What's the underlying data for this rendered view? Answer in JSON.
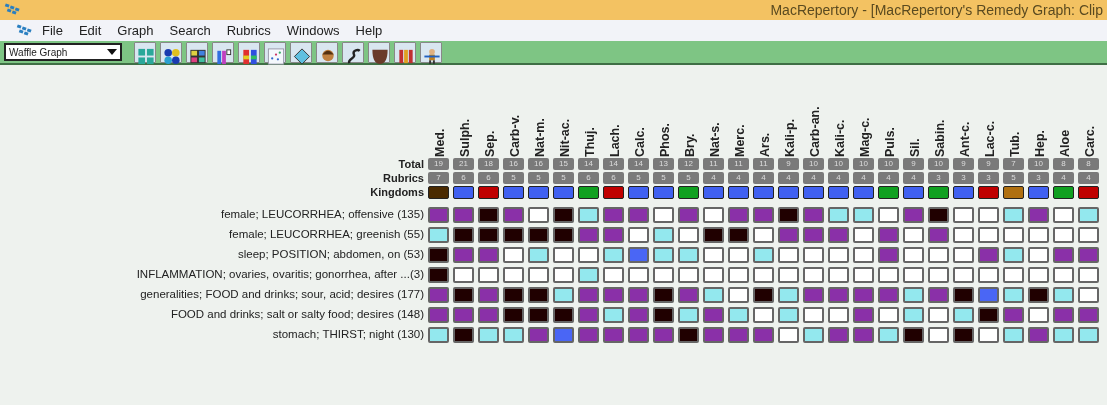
{
  "window": {
    "title": "MacRepertory - [MacRepertory's Remedy Graph: Clip"
  },
  "menu": [
    "File",
    "Edit",
    "Graph",
    "Search",
    "Rubrics",
    "Windows",
    "Help"
  ],
  "toolbar": {
    "view_select": "Waffle Graph"
  },
  "header_labels": {
    "total": "Total",
    "rubrics": "Rubrics",
    "kingdoms": "Kingdoms"
  },
  "remedies": [
    {
      "name": "Med.",
      "total": "19",
      "rubrics": "7",
      "color": "#4a2a00"
    },
    {
      "name": "Sulph.",
      "total": "21",
      "rubrics": "6",
      "color": "#4060f0"
    },
    {
      "name": "Sep.",
      "total": "18",
      "rubrics": "6",
      "color": "#c00000"
    },
    {
      "name": "Carb-v.",
      "total": "16",
      "rubrics": "5",
      "color": "#4060f0"
    },
    {
      "name": "Nat-m.",
      "total": "16",
      "rubrics": "5",
      "color": "#4060f0"
    },
    {
      "name": "Nit-ac.",
      "total": "15",
      "rubrics": "5",
      "color": "#4060f0"
    },
    {
      "name": "Thuj.",
      "total": "14",
      "rubrics": "6",
      "color": "#10a020"
    },
    {
      "name": "Lach.",
      "total": "14",
      "rubrics": "6",
      "color": "#c00000"
    },
    {
      "name": "Calc.",
      "total": "14",
      "rubrics": "5",
      "color": "#4060f0"
    },
    {
      "name": "Phos.",
      "total": "13",
      "rubrics": "5",
      "color": "#4060f0"
    },
    {
      "name": "Bry.",
      "total": "12",
      "rubrics": "5",
      "color": "#10a020"
    },
    {
      "name": "Nat-s.",
      "total": "11",
      "rubrics": "4",
      "color": "#4060f0"
    },
    {
      "name": "Merc.",
      "total": "11",
      "rubrics": "4",
      "color": "#4060f0"
    },
    {
      "name": "Ars.",
      "total": "11",
      "rubrics": "4",
      "color": "#4060f0"
    },
    {
      "name": "Kali-p.",
      "total": "9",
      "rubrics": "4",
      "color": "#4060f0"
    },
    {
      "name": "Carb-an.",
      "total": "10",
      "rubrics": "4",
      "color": "#4060f0"
    },
    {
      "name": "Kali-c.",
      "total": "10",
      "rubrics": "4",
      "color": "#4060f0"
    },
    {
      "name": "Mag-c.",
      "total": "10",
      "rubrics": "4",
      "color": "#4060f0"
    },
    {
      "name": "Puls.",
      "total": "10",
      "rubrics": "4",
      "color": "#10a020"
    },
    {
      "name": "Sil.",
      "total": "9",
      "rubrics": "4",
      "color": "#4060f0"
    },
    {
      "name": "Sabin.",
      "total": "10",
      "rubrics": "3",
      "color": "#10a020"
    },
    {
      "name": "Ant-c.",
      "total": "9",
      "rubrics": "3",
      "color": "#4060f0"
    },
    {
      "name": "Lac-c.",
      "total": "9",
      "rubrics": "3",
      "color": "#c00000"
    },
    {
      "name": "Tub.",
      "total": "7",
      "rubrics": "5",
      "color": "#b07010"
    },
    {
      "name": "Hep.",
      "total": "10",
      "rubrics": "3",
      "color": "#4060f0"
    },
    {
      "name": "Aloe",
      "total": "8",
      "rubrics": "4",
      "color": "#10a020"
    },
    {
      "name": "Carc.",
      "total": "8",
      "rubrics": "4",
      "color": "#c00000"
    }
  ],
  "rows": [
    {
      "label": "female; LEUCORRHEA; offensive (135)",
      "cells": [
        {
          "color": "#8a30a8"
        },
        {
          "color": "#8a30a8"
        },
        {
          "color": "#200000"
        },
        {
          "color": "#8a30a8"
        },
        {
          "color": "#ffffff"
        },
        {
          "color": "#200000"
        },
        {
          "color": "#93e8ee"
        },
        {
          "color": "#8a30a8"
        },
        {
          "color": "#8a30a8"
        },
        {
          "color": "#ffffff"
        },
        {
          "color": "#8a30a8"
        },
        {
          "color": "#ffffff"
        },
        {
          "color": "#8a30a8"
        },
        {
          "color": "#8a30a8"
        },
        {
          "color": "#200000"
        },
        {
          "color": "#8a30a8"
        },
        {
          "color": "#93e8ee"
        },
        {
          "color": "#93e8ee"
        },
        {
          "color": "#ffffff"
        },
        {
          "color": "#8a30a8"
        },
        {
          "color": "#200000"
        },
        {
          "color": "#ffffff"
        },
        {
          "color": "#ffffff"
        },
        {
          "color": "#93e8ee"
        },
        {
          "color": "#8a30a8"
        },
        {
          "color": "#ffffff"
        },
        {
          "color": "#93e8ee"
        }
      ]
    },
    {
      "label": "female; LEUCORRHEA; greenish (55)",
      "cells": [
        {
          "color": "#93e8ee"
        },
        {
          "color": "#200000"
        },
        {
          "color": "#200000"
        },
        {
          "color": "#200000"
        },
        {
          "color": "#200000"
        },
        {
          "color": "#200000"
        },
        {
          "color": "#8a30a8"
        },
        {
          "color": "#8a30a8"
        },
        {
          "color": "#ffffff"
        },
        {
          "color": "#93e8ee"
        },
        {
          "color": "#ffffff"
        },
        {
          "color": "#200000"
        },
        {
          "color": "#200000"
        },
        {
          "color": "#ffffff"
        },
        {
          "color": "#8a30a8"
        },
        {
          "color": "#8a30a8"
        },
        {
          "color": "#8a30a8"
        },
        {
          "color": "#ffffff"
        },
        {
          "color": "#8a30a8"
        },
        {
          "color": "#ffffff"
        },
        {
          "color": "#8a30a8"
        },
        {
          "color": "#ffffff"
        },
        {
          "color": "#ffffff"
        },
        {
          "color": "#ffffff"
        },
        {
          "color": "#ffffff"
        },
        {
          "color": "#ffffff"
        },
        {
          "color": "#ffffff"
        }
      ]
    },
    {
      "label": "sleep; POSITION; abdomen, on (53)",
      "cells": [
        {
          "color": "#200000"
        },
        {
          "color": "#8a30a8"
        },
        {
          "color": "#8a30a8"
        },
        {
          "color": "#ffffff"
        },
        {
          "color": "#93e8ee"
        },
        {
          "color": "#ffffff"
        },
        {
          "color": "#ffffff"
        },
        {
          "color": "#93e8ee"
        },
        {
          "color": "#4a66f5"
        },
        {
          "color": "#93e8ee"
        },
        {
          "color": "#93e8ee"
        },
        {
          "color": "#ffffff"
        },
        {
          "color": "#ffffff"
        },
        {
          "color": "#93e8ee"
        },
        {
          "color": "#ffffff"
        },
        {
          "color": "#ffffff"
        },
        {
          "color": "#ffffff"
        },
        {
          "color": "#ffffff"
        },
        {
          "color": "#8a30a8"
        },
        {
          "color": "#ffffff"
        },
        {
          "color": "#ffffff"
        },
        {
          "color": "#ffffff"
        },
        {
          "color": "#8a30a8"
        },
        {
          "color": "#93e8ee"
        },
        {
          "color": "#ffffff"
        },
        {
          "color": "#8a30a8"
        },
        {
          "color": "#8a30a8"
        }
      ]
    },
    {
      "label": "INFLAMMATION; ovaries, ovaritis; gonorrhea, after ...(3)",
      "cells": [
        {
          "color": "#200000"
        },
        {
          "color": "#ffffff"
        },
        {
          "color": "#ffffff"
        },
        {
          "color": "#ffffff"
        },
        {
          "color": "#ffffff"
        },
        {
          "color": "#ffffff"
        },
        {
          "color": "#93e8ee"
        },
        {
          "color": "#ffffff"
        },
        {
          "color": "#ffffff"
        },
        {
          "color": "#ffffff"
        },
        {
          "color": "#ffffff"
        },
        {
          "color": "#ffffff"
        },
        {
          "color": "#ffffff"
        },
        {
          "color": "#ffffff"
        },
        {
          "color": "#ffffff"
        },
        {
          "color": "#ffffff"
        },
        {
          "color": "#ffffff"
        },
        {
          "color": "#ffffff"
        },
        {
          "color": "#ffffff"
        },
        {
          "color": "#ffffff"
        },
        {
          "color": "#ffffff"
        },
        {
          "color": "#ffffff"
        },
        {
          "color": "#ffffff"
        },
        {
          "color": "#ffffff"
        },
        {
          "color": "#ffffff"
        },
        {
          "color": "#ffffff"
        },
        {
          "color": "#ffffff"
        }
      ]
    },
    {
      "label": "generalities; FOOD and drinks; sour, acid; desires (177)",
      "cells": [
        {
          "color": "#8a30a8"
        },
        {
          "color": "#200000"
        },
        {
          "color": "#8a30a8"
        },
        {
          "color": "#200000"
        },
        {
          "color": "#200000"
        },
        {
          "color": "#93e8ee"
        },
        {
          "color": "#8a30a8"
        },
        {
          "color": "#8a30a8"
        },
        {
          "color": "#8a30a8"
        },
        {
          "color": "#200000"
        },
        {
          "color": "#8a30a8"
        },
        {
          "color": "#93e8ee"
        },
        {
          "color": "#ffffff"
        },
        {
          "color": "#200000"
        },
        {
          "color": "#93e8ee"
        },
        {
          "color": "#8a30a8"
        },
        {
          "color": "#8a30a8"
        },
        {
          "color": "#8a30a8"
        },
        {
          "color": "#8a30a8"
        },
        {
          "color": "#93e8ee"
        },
        {
          "color": "#8a30a8"
        },
        {
          "color": "#200000"
        },
        {
          "color": "#4a66f5"
        },
        {
          "color": "#93e8ee"
        },
        {
          "color": "#200000"
        },
        {
          "color": "#93e8ee"
        },
        {
          "color": "#ffffff"
        }
      ]
    },
    {
      "label": "FOOD and drinks; salt or salty food; desires (148)",
      "cells": [
        {
          "color": "#8a30a8"
        },
        {
          "color": "#8a30a8"
        },
        {
          "color": "#8a30a8"
        },
        {
          "color": "#200000"
        },
        {
          "color": "#200000"
        },
        {
          "color": "#200000"
        },
        {
          "color": "#8a30a8"
        },
        {
          "color": "#93e8ee"
        },
        {
          "color": "#8a30a8"
        },
        {
          "color": "#200000"
        },
        {
          "color": "#93e8ee"
        },
        {
          "color": "#8a30a8"
        },
        {
          "color": "#93e8ee"
        },
        {
          "color": "#ffffff"
        },
        {
          "color": "#93e8ee"
        },
        {
          "color": "#ffffff"
        },
        {
          "color": "#ffffff"
        },
        {
          "color": "#8a30a8"
        },
        {
          "color": "#ffffff"
        },
        {
          "color": "#93e8ee"
        },
        {
          "color": "#ffffff"
        },
        {
          "color": "#93e8ee"
        },
        {
          "color": "#200000"
        },
        {
          "color": "#8a30a8"
        },
        {
          "color": "#ffffff"
        },
        {
          "color": "#8a30a8"
        },
        {
          "color": "#8a30a8"
        }
      ]
    },
    {
      "label": "stomach; THIRST; night (130)",
      "cells": [
        {
          "color": "#93e8ee"
        },
        {
          "color": "#200000"
        },
        {
          "color": "#93e8ee"
        },
        {
          "color": "#93e8ee"
        },
        {
          "color": "#8a30a8"
        },
        {
          "color": "#4a66f5"
        },
        {
          "color": "#8a30a8"
        },
        {
          "color": "#8a30a8"
        },
        {
          "color": "#8a30a8"
        },
        {
          "color": "#8a30a8"
        },
        {
          "color": "#200000"
        },
        {
          "color": "#8a30a8"
        },
        {
          "color": "#8a30a8"
        },
        {
          "color": "#8a30a8"
        },
        {
          "color": "#ffffff"
        },
        {
          "color": "#93e8ee"
        },
        {
          "color": "#8a30a8"
        },
        {
          "color": "#8a30a8"
        },
        {
          "color": "#93e8ee"
        },
        {
          "color": "#200000"
        },
        {
          "color": "#ffffff"
        },
        {
          "color": "#200000"
        },
        {
          "color": "#ffffff"
        },
        {
          "color": "#93e8ee"
        },
        {
          "color": "#8a30a8"
        },
        {
          "color": "#93e8ee"
        },
        {
          "color": "#93e8ee"
        }
      ]
    }
  ]
}
